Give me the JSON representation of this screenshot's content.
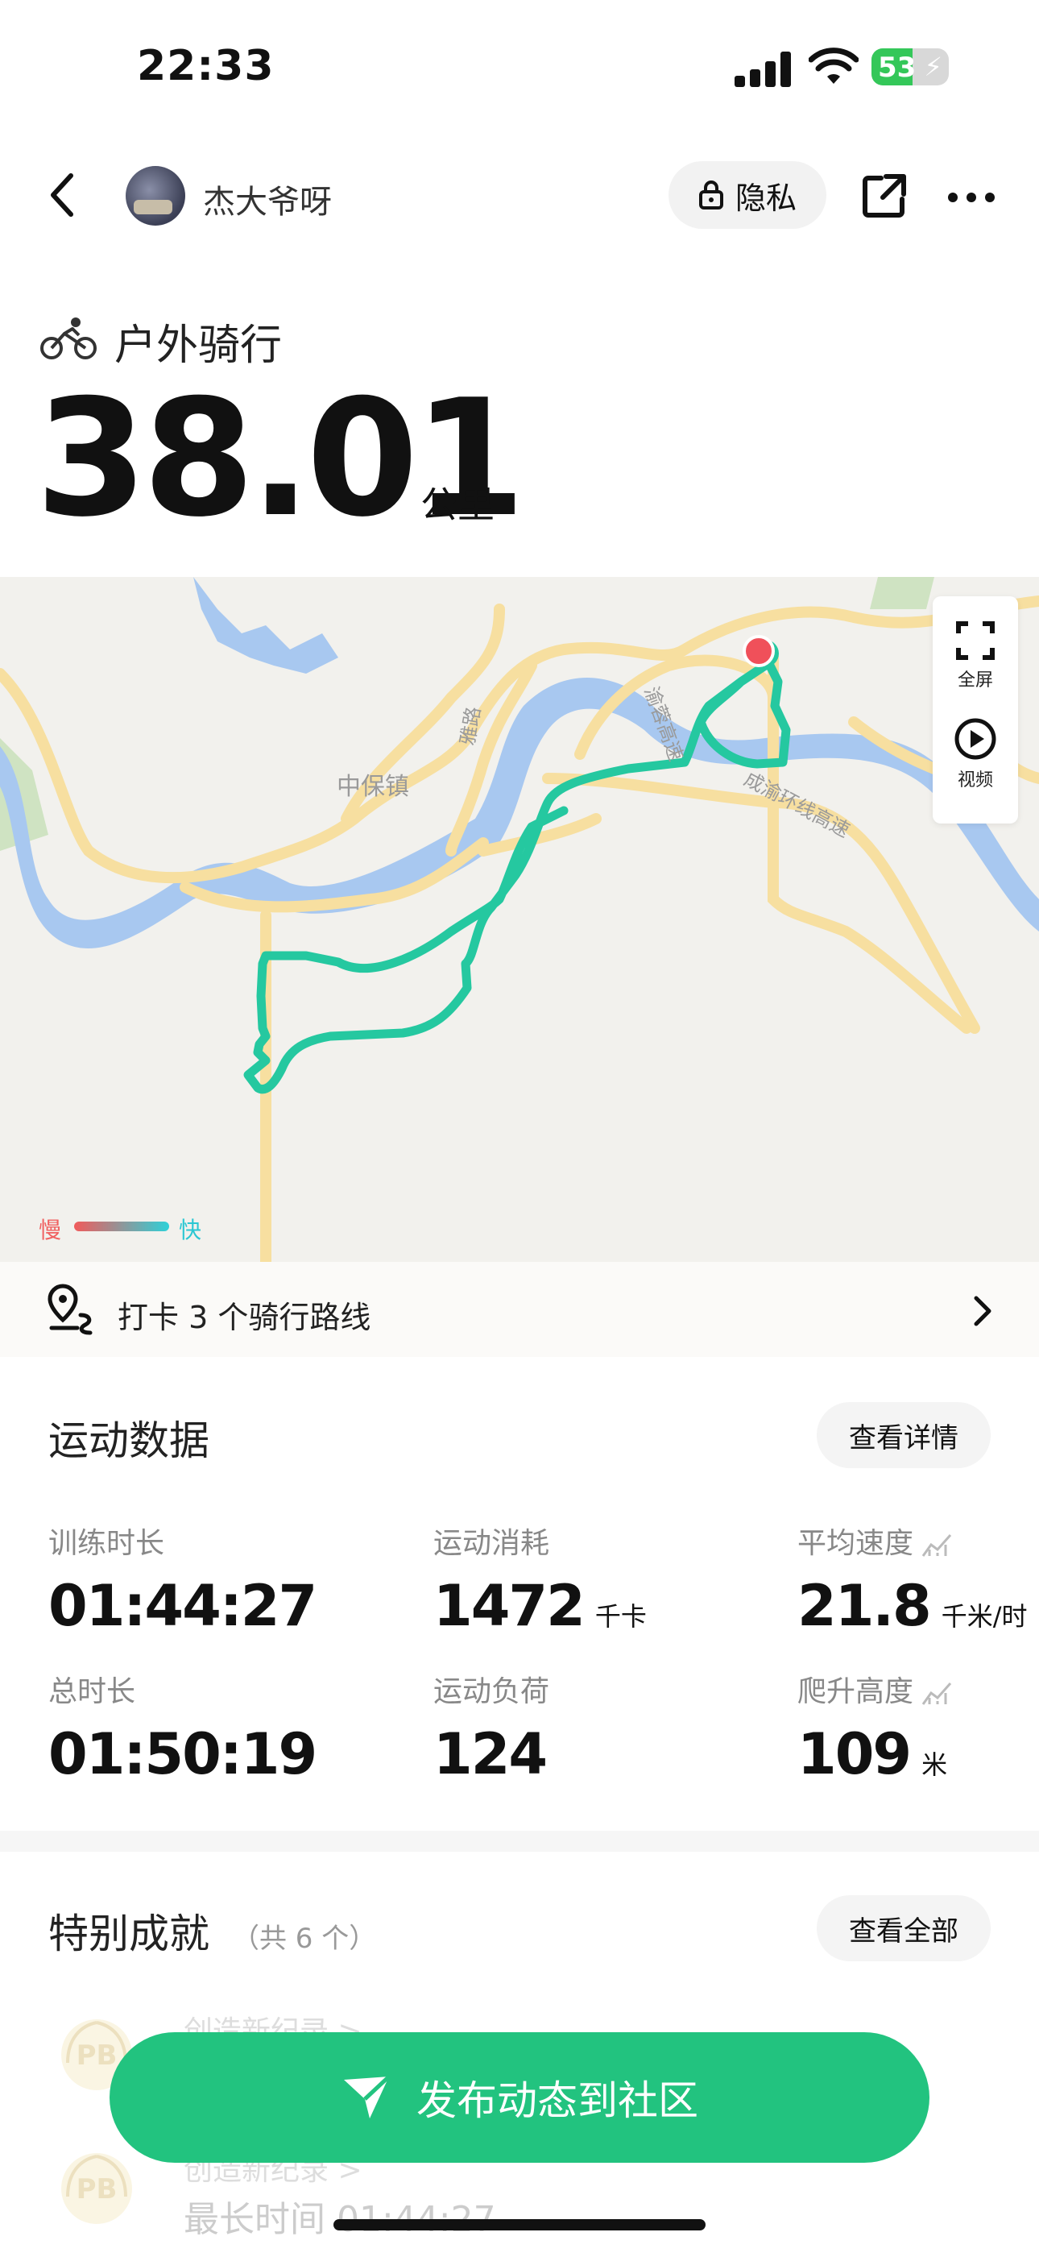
{
  "status_bar": {
    "time": "22:33",
    "battery": "53",
    "battery_level": 0.53
  },
  "header": {
    "username": "杰大爷呀",
    "privacy_label": "隐私"
  },
  "activity": {
    "type": "户外骑行",
    "distance": "38.01",
    "distance_unit": "公里"
  },
  "map": {
    "fullscreen_label": "全屏",
    "video_label": "视频",
    "legend_slow": "慢",
    "legend_fast": "快",
    "place_labels": [
      "中保镇",
      "成渝环线高速",
      "雅路",
      "渝蓉高速"
    ]
  },
  "checkin": {
    "text": "打卡 3 个骑行路线"
  },
  "workout": {
    "title": "运动数据",
    "details_button": "查看详情",
    "stats": [
      {
        "label": "训练时长",
        "value": "01:44:27",
        "unit": ""
      },
      {
        "label": "运动消耗",
        "value": "1472",
        "unit": "千卡"
      },
      {
        "label": "平均速度",
        "value": "21.8",
        "unit": "千米/时"
      },
      {
        "label": "总时长",
        "value": "01:50:19",
        "unit": ""
      },
      {
        "label": "运动负荷",
        "value": "124",
        "unit": ""
      },
      {
        "label": "爬升高度",
        "value": "109",
        "unit": "米"
      }
    ]
  },
  "achievements": {
    "title": "特别成就",
    "count_text": "（共 6 个）",
    "view_all_button": "查看全部",
    "items": [
      {
        "badge": "PB",
        "title": "创造新纪录 >",
        "detail": ""
      },
      {
        "badge": "PB",
        "title": "创造新纪录 >",
        "detail": "最长时间 01:44:27"
      }
    ]
  },
  "publish_button": "发布动态到社区",
  "colors": {
    "accent": "#22c37f",
    "route": "#25c8a0",
    "start_marker": "#f0505a",
    "road": "#f7dfa0",
    "water": "#a8c8f0"
  }
}
